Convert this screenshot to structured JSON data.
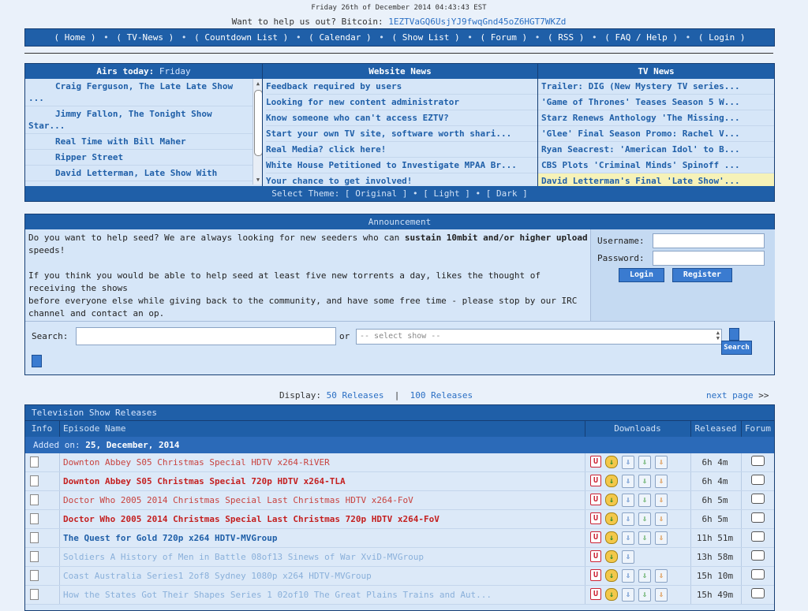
{
  "header": {
    "datetime": "Friday 26th of December 2014 04:43:43 EST",
    "bitcoin_label": "Want to help us out? Bitcoin: ",
    "bitcoin_address": "1EZTVaGQ6UsjYJ9fwqGnd45oZ6HGT7WKZd"
  },
  "nav": {
    "items": [
      "Home",
      "TV-News",
      "Countdown List",
      "Calendar",
      "Show List",
      "Forum",
      "RSS",
      "FAQ / Help",
      "Login"
    ]
  },
  "airs_today": {
    "title": "Airs today:",
    "day": "Friday",
    "items": [
      {
        "line1": "Craig Ferguson, The Late Late Show",
        "line2": "..."
      },
      {
        "line1": "Jimmy Fallon, The Tonight Show",
        "line2": "Star..."
      },
      {
        "line1": "Real Time with Bill Maher",
        "line2": ""
      },
      {
        "line1": "Ripper Street",
        "line2": ""
      },
      {
        "line1": "David Letterman, Late Show With",
        "line2": ""
      }
    ]
  },
  "website_news": {
    "title": "Website News",
    "items": [
      "Feedback required by users",
      "Looking for new content administrator",
      "Know someone who can't access EZTV?",
      "Start your own TV site, software worth shari...",
      "Real Media? click here!",
      "White House Petitioned to Investigate MPAA Br...",
      "Your chance to get involved!"
    ]
  },
  "tv_news": {
    "title": "TV News",
    "items": [
      "Trailer: DIG (New Mystery TV series...",
      "'Game of Thrones' Teases Season 5 W...",
      "Starz Renews Anthology 'The Missing...",
      "'Glee' Final Season Promo: Rachel V...",
      "Ryan Seacrest: 'American Idol' to B...",
      "CBS Plots 'Criminal Minds' Spinoff ...",
      "David Letterman's Final 'Late Show'..."
    ]
  },
  "theme": {
    "label": "Select Theme:",
    "options": [
      "Original",
      "Light",
      "Dark"
    ]
  },
  "announcement": {
    "title": "Announcement",
    "p1_a": "Do you want to help seed? We are always looking for new seeders who can ",
    "p1_bold": "sustain 10mbit and/or higher upload",
    "p1_b": " speeds!",
    "p2": "If you think you would be able to help seed at least five new torrents a day, likes the thought of receiving the shows",
    "p3": "before everyone else while giving back to the community, and have some free time - please stop by our IRC channel and contact an op."
  },
  "login": {
    "username_label": "Username:",
    "password_label": "Password:",
    "login_btn": "Login",
    "register_btn": "Register"
  },
  "search": {
    "label": "Search:",
    "or": "or",
    "select_placeholder": "-- select show --",
    "button": "Search"
  },
  "display": {
    "label": "Display:",
    "opt1": "50 Releases",
    "sep": "|",
    "opt2": "100 Releases",
    "next": "next page",
    "next_arrows": ">>"
  },
  "releases": {
    "title": "Television Show Releases",
    "columns": [
      "Info",
      "Episode Name",
      "Downloads",
      "Released",
      "Forum"
    ],
    "added_label": "Added on:",
    "added_date": "25, December, 2014",
    "rows": [
      {
        "name": "Downton Abbey S05 Christmas Special HDTV x264-RiVER",
        "style": "red",
        "time": "6h 4m",
        "dl": 4
      },
      {
        "name": "Downton Abbey S05 Christmas Special 720p HDTV x264-TLA",
        "style": "redb",
        "time": "6h 4m",
        "dl": 4
      },
      {
        "name": "Doctor Who 2005 2014 Christmas Special Last Christmas HDTV x264-FoV",
        "style": "red",
        "time": "6h 5m",
        "dl": 4
      },
      {
        "name": "Doctor Who 2005 2014 Christmas Special Last Christmas 720p HDTV x264-FoV",
        "style": "redb",
        "time": "6h 5m",
        "dl": 4
      },
      {
        "name": "The Quest for Gold 720p x264 HDTV-MVGroup",
        "style": "blueb",
        "time": "11h 51m",
        "dl": 4
      },
      {
        "name": "Soldiers A History of Men in Battle 08of13 Sinews of War XviD-MVGroup",
        "style": "faint",
        "time": "13h 58m",
        "dl": 2
      },
      {
        "name": "Coast Australia Series1 2of8 Sydney 1080p x264 HDTV-MVGroup",
        "style": "faint",
        "time": "15h 10m",
        "dl": 4
      },
      {
        "name": "How the States Got Their Shapes Series 1 02of10 The Great Plains Trains and Aut...",
        "style": "faint",
        "time": "15h 49m",
        "dl": 4
      }
    ]
  }
}
